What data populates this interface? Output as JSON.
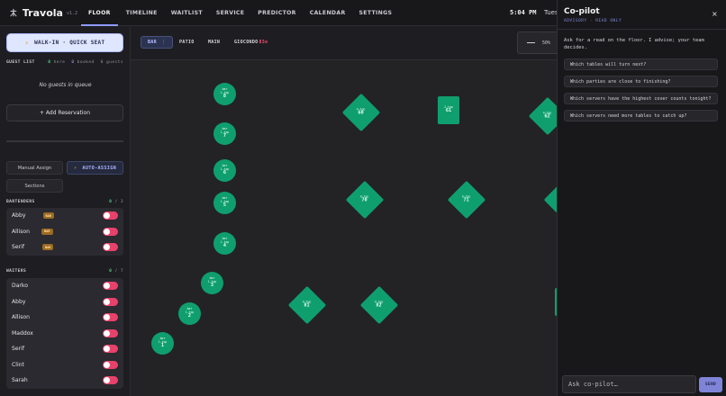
{
  "app": {
    "name": "Travola",
    "version": "v1.2"
  },
  "nav": [
    {
      "label": "FLOOR",
      "active": true
    },
    {
      "label": "TIMELINE"
    },
    {
      "label": "WAITLIST"
    },
    {
      "label": "SERVICE"
    },
    {
      "label": "PREDICTOR"
    },
    {
      "label": "CALENDAR"
    },
    {
      "label": "SETTINGS"
    }
  ],
  "clock": {
    "time": "5:04 PM",
    "day": "Tues"
  },
  "sidebar": {
    "walkin_label": "WALK-IN · QUICK SEAT",
    "guest_list": {
      "title": "GUEST LIST",
      "here_count": "0",
      "here_label": "here",
      "booked_count": "0",
      "booked_label": "booked",
      "guests_count": "0",
      "guests_label": "guests"
    },
    "empty_queue": "No guests in queue",
    "add_reservation": "+ Add Reservation",
    "manual_assign": "Manual Assign",
    "auto_assign": "AUTO-ASSIGN",
    "sections": "Sections",
    "bartenders": {
      "title": "BARTENDERS",
      "count_on": "0",
      "count_total": "/ 3",
      "people": [
        {
          "name": "Abby",
          "badge": "BAR"
        },
        {
          "name": "Allison",
          "badge": "BAR"
        },
        {
          "name": "Serif",
          "badge": "BAR"
        }
      ]
    },
    "waiters": {
      "title": "WAITERS",
      "count_on": "0",
      "count_total": "/ 7",
      "people": [
        {
          "name": "Darko"
        },
        {
          "name": "Abby"
        },
        {
          "name": "Allison"
        },
        {
          "name": "Maddox"
        },
        {
          "name": "Serif"
        },
        {
          "name": "Clint"
        },
        {
          "name": "Sarah"
        }
      ]
    }
  },
  "floor": {
    "tabs": [
      {
        "label": "BAR",
        "active": true,
        "extra": "⋮"
      },
      {
        "label": "PATIO"
      },
      {
        "label": "MAIN"
      },
      {
        "label": "GIOCONDO",
        "extra": "83⊘"
      }
    ],
    "zoom": "50%",
    "tables": [
      {
        "id": "8",
        "caption": "bar\n1-top",
        "shape": "round"
      },
      {
        "id": "7",
        "caption": "bar\n1-top",
        "shape": "round"
      },
      {
        "id": "6",
        "caption": "bar\n1-top",
        "shape": "round"
      },
      {
        "id": "5",
        "caption": "bar\n1-top",
        "shape": "round"
      },
      {
        "id": "4",
        "caption": "bar\n1-top",
        "shape": "round"
      },
      {
        "id": "3",
        "caption": "bar\n1-top",
        "shape": "round"
      },
      {
        "id": "2",
        "caption": "bar\n1-top",
        "shape": "round"
      },
      {
        "id": "1",
        "caption": "bar\n1-top",
        "shape": "round"
      },
      {
        "id": "60",
        "caption": "4-top",
        "shape": "diamond"
      },
      {
        "id": "61",
        "caption": "2-top",
        "shape": "rect"
      },
      {
        "id": "62",
        "caption": "4-top",
        "shape": "diamond"
      },
      {
        "id": "70",
        "caption": "4-top",
        "shape": "diamond"
      },
      {
        "id": "71",
        "caption": "4-top",
        "shape": "diamond"
      },
      {
        "id": "80",
        "caption": "4-top",
        "shape": "diamond"
      },
      {
        "id": "81",
        "caption": "4-top",
        "shape": "diamond"
      },
      {
        "id": "82",
        "caption": "4-top",
        "shape": "diamond"
      }
    ]
  },
  "copilot": {
    "title": "Co-pilot",
    "subtitle": "ADVISORY · READ ONLY",
    "close": "×",
    "intro": "Ask for a read on the floor. I advise; your team decides.",
    "suggestions": [
      "Which tables will turn next?",
      "Which parties are close to finishing?",
      "Which servers have the highest cover counts tonight?",
      "Which servers need more tables to catch up?"
    ],
    "input_placeholder": "Ask co-pilot…",
    "send": "SEND"
  },
  "colors": {
    "table": "#0f9f6e",
    "accent": "#8f9bff",
    "toggle_off": "#e8416a",
    "badge": "#9a6a21"
  }
}
